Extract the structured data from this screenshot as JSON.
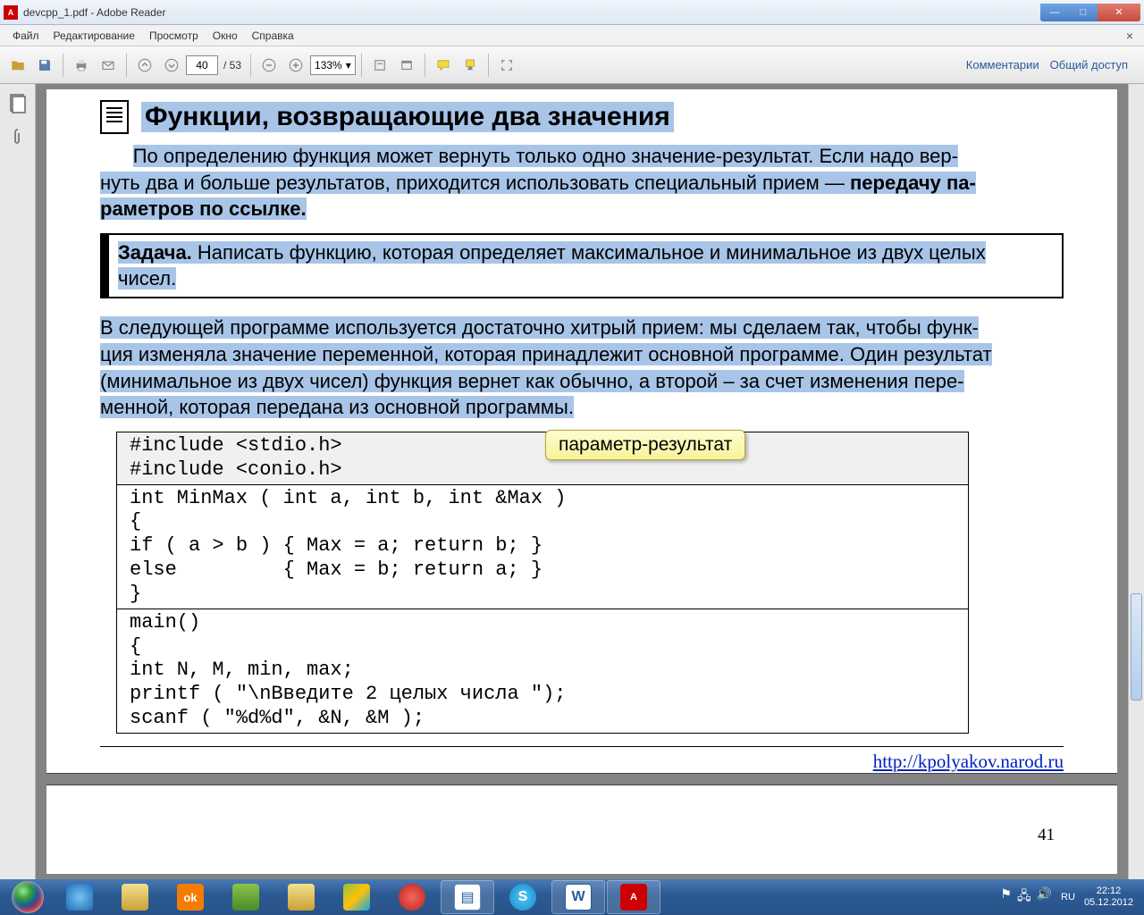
{
  "titlebar": {
    "title": "devcpp_1.pdf - Adobe Reader"
  },
  "menu": {
    "items": [
      "Файл",
      "Редактирование",
      "Просмотр",
      "Окно",
      "Справка"
    ]
  },
  "toolbar": {
    "page_current": "40",
    "page_total": "/ 53",
    "zoom": "133%",
    "comments": "Комментарии",
    "share": "Общий доступ"
  },
  "document": {
    "heading": "Функции, возвращающие два значения",
    "para1_a": "По определению функция может вернуть только одно значение-результат. Если надо вер-",
    "para1_b": "нуть два и больше результатов, приходится использовать специальный прием — ",
    "para1_bold": "передачу па-",
    "para1_c": "раметров по ссылке.",
    "task_label": "Задача.",
    "task_text": " Написать функцию, которая определяет максимальное и минимальное из двух целых",
    "task_text2": "чисел.",
    "para2": "В следующей программе используется достаточно хитрый прием: мы сделаем так, чтобы функ-",
    "para2b": "ция изменяла значение переменной, которая принадлежит основной программе. Один результат",
    "para2c": "(минимальное из двух чисел) функция вернет как обычно, а второй – за счет изменения пере-",
    "para2d": "менной, которая передана из основной программы.",
    "callout": "параметр-результат",
    "code": {
      "includes": "#include <stdio.h>\n#include <conio.h>",
      "func": "int MinMax ( int a, int b, int &Max )\n{\nif ( a > b ) { Max = a; return b; }\nelse         { Max = b; return a; }\n}",
      "main": "main()\n{\nint N, M, min, max;\nprintf ( \"\\nВведите 2 целых числа \");\nscanf ( \"%d%d\", &N, &M );"
    },
    "footer_url": "http://kpolyakov.narod.ru",
    "page_num": "41"
  },
  "taskbar": {
    "lang": "RU",
    "time": "22:12",
    "date": "05.12.2012"
  }
}
